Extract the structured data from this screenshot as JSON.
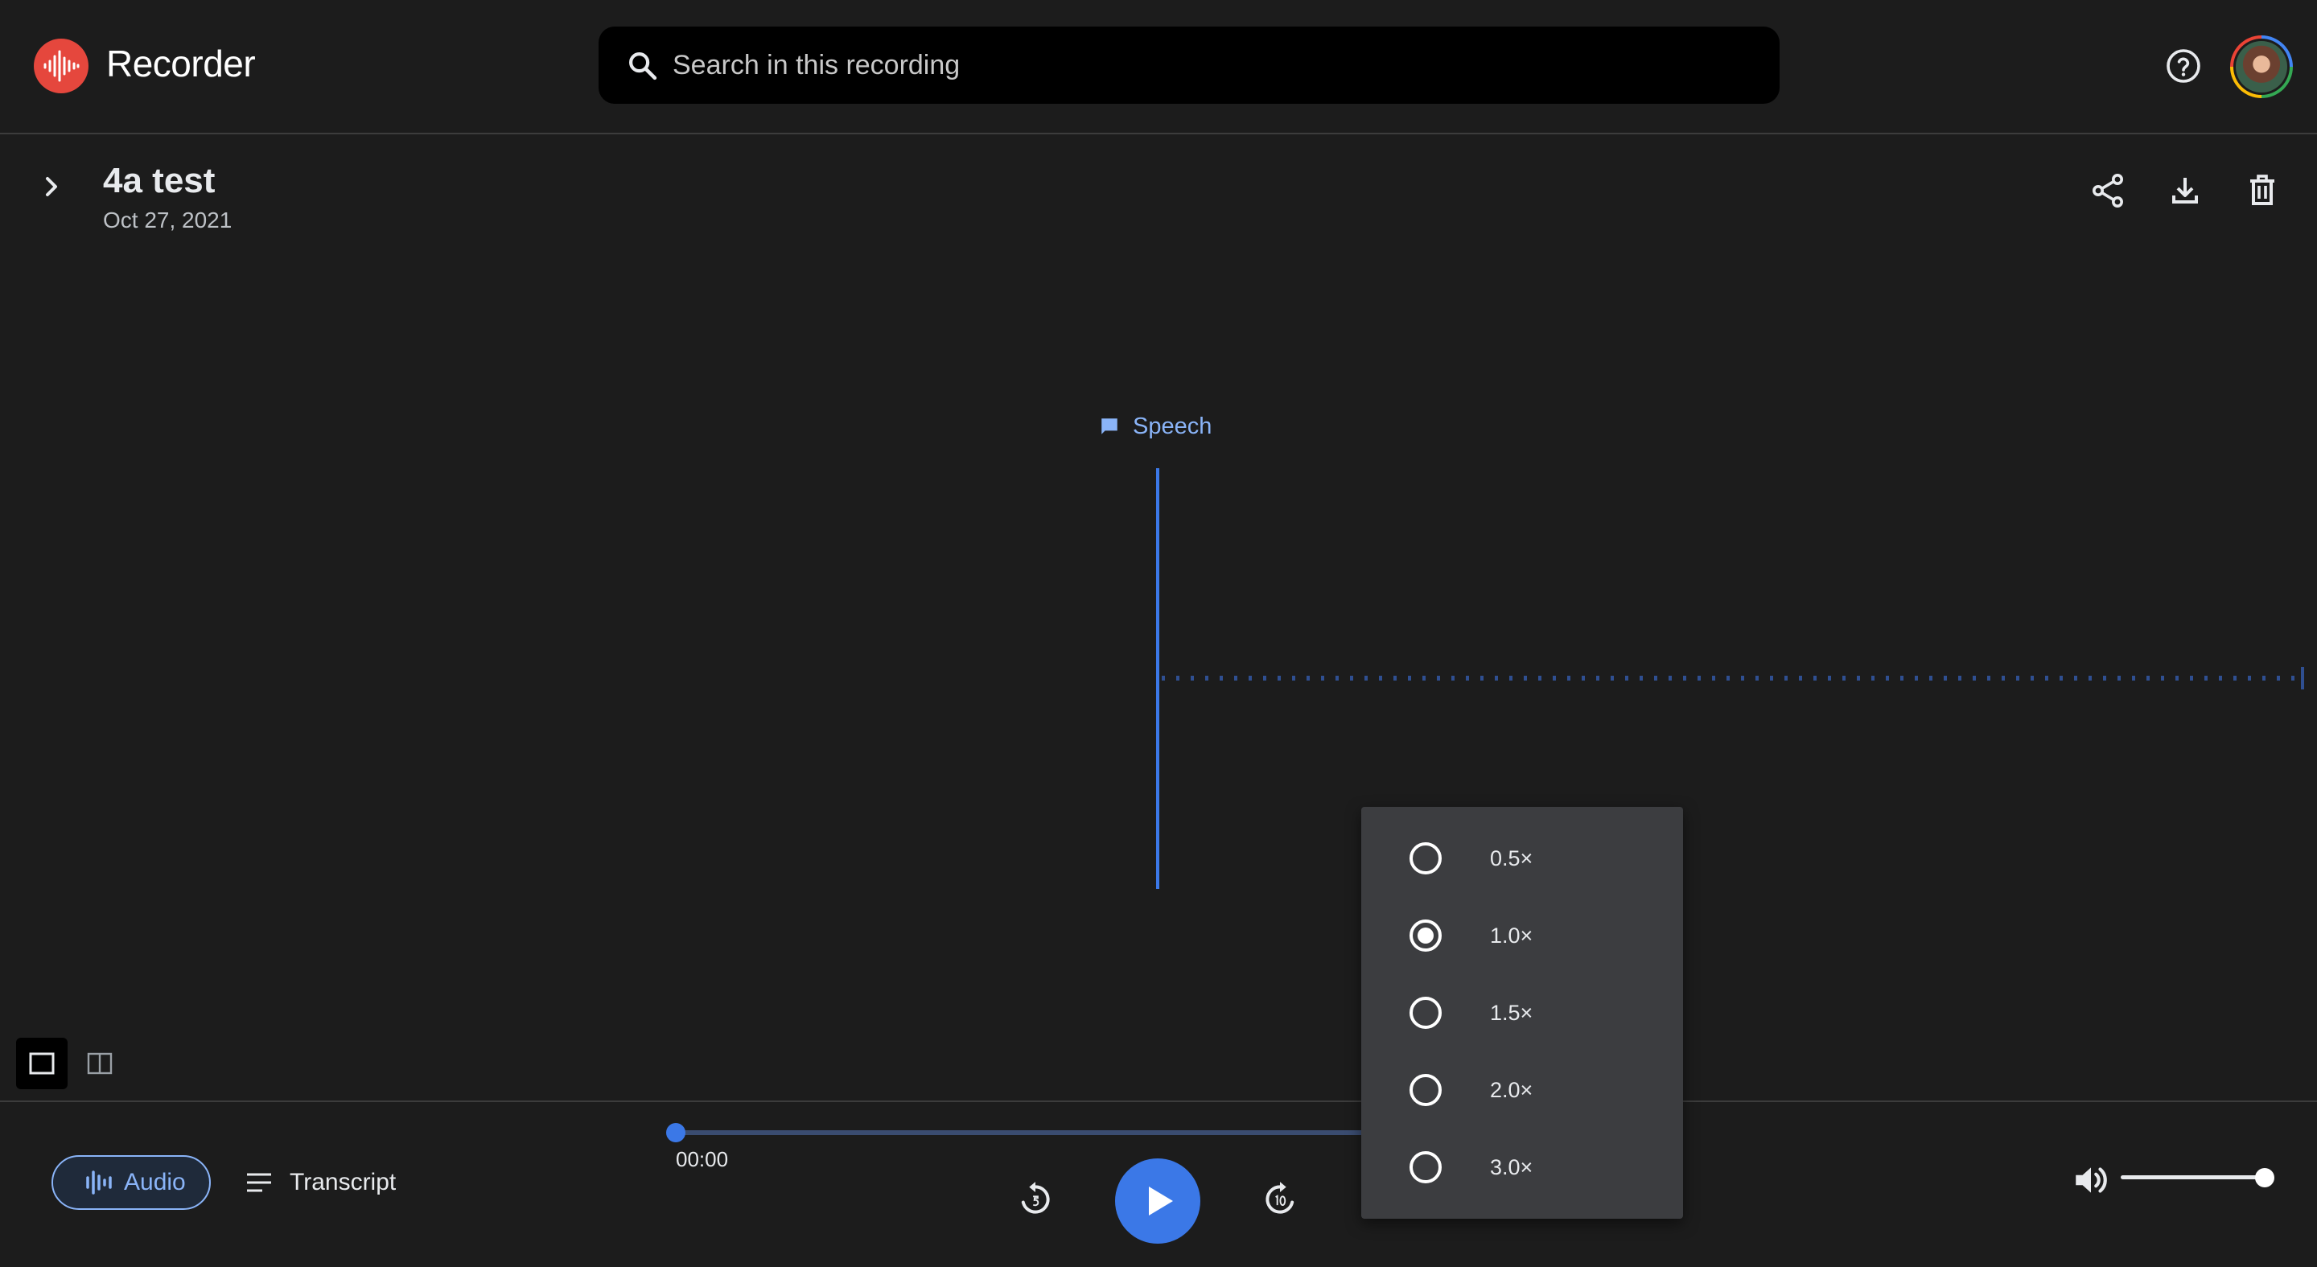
{
  "app": {
    "title": "Recorder"
  },
  "search": {
    "placeholder": "Search in this recording"
  },
  "recording": {
    "title": "4a test",
    "date": "Oct 27, 2021"
  },
  "waveform": {
    "label": "Speech"
  },
  "tabs": {
    "audio": "Audio",
    "transcript": "Transcript"
  },
  "player": {
    "current_time": "00:00",
    "progress": 0.0,
    "volume": 1.0
  },
  "speed_menu": {
    "options": [
      "0.5×",
      "1.0×",
      "1.5×",
      "2.0×",
      "3.0×"
    ],
    "selected": "1.0×"
  },
  "colors": {
    "accent": "#8ab4f8",
    "brand": "#e5473d",
    "play": "#3b78e7",
    "background": "#1c1c1c",
    "menu": "#3c3d40"
  },
  "icons": [
    "recorder-logo-icon",
    "search-icon",
    "help-icon",
    "chevron-right-icon",
    "share-icon",
    "download-icon",
    "delete-icon",
    "speech-icon",
    "single-view-icon",
    "split-view-icon",
    "waveform-icon",
    "transcript-icon",
    "rewind-icon",
    "play-icon",
    "forward-icon",
    "volume-icon"
  ]
}
